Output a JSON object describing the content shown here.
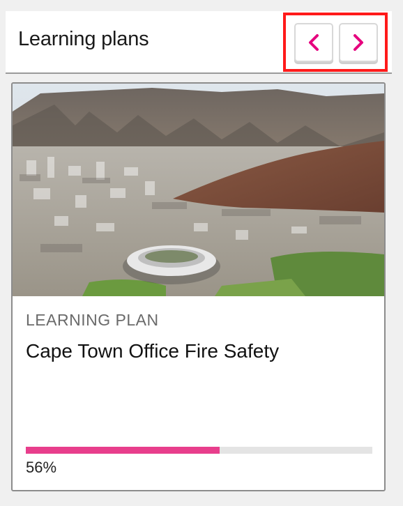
{
  "header": {
    "title": "Learning plans"
  },
  "nav": {
    "prev_icon": "chevron-left-icon",
    "next_icon": "chevron-right-icon",
    "icon_color": "#e6007e",
    "highlight_color": "#ff1a1a"
  },
  "card": {
    "image_alt": "Aerial view of Cape Town with stadium and Table Mountain",
    "type_label": "LEARNING PLAN",
    "title": "Cape Town Office Fire Safety",
    "progress": {
      "value": 56,
      "label": "56%",
      "color": "#e83e8c"
    }
  }
}
